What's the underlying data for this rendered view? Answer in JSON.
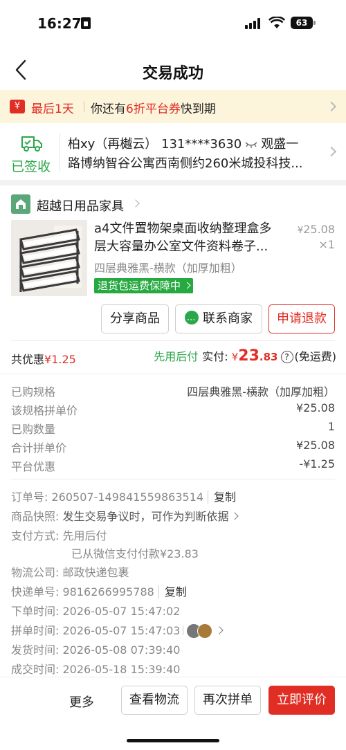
{
  "status_bar": {
    "time": "16:27",
    "battery": "63"
  },
  "nav": {
    "title": "交易成功"
  },
  "coupon_banner": {
    "icon_glyph": "¥",
    "deadline": "最后1天",
    "text_prefix": "你还有",
    "highlight": "6折平台券",
    "text_suffix": "快到期"
  },
  "delivery": {
    "status": "已签收",
    "contact": "柏xy（再樾云） 131****3630",
    "address_part1": "观盛一",
    "address_line2": "路博纳智谷公寓西南侧约260米城投科技..."
  },
  "store": {
    "name": "超越日用品家具"
  },
  "product": {
    "title": "a4文件置物架桌面收纳整理盒多层大容量办公室文件资料卷子...",
    "price_currency": "¥",
    "price": "25.08",
    "quantity": "×1",
    "spec": "四层典雅黑-横款（加厚加粗）",
    "guarantee": "退货包运费保障中"
  },
  "actions": {
    "share": "分享商品",
    "contact": "联系商家",
    "refund": "申请退款"
  },
  "summary": {
    "discount_label": "共优惠",
    "discount_value": "¥1.25",
    "pay_later": "先用后付",
    "paid_label": "实付:",
    "paid_currency": "¥",
    "paid_int": "23",
    "paid_dec": ".83",
    "help": "?",
    "shipping": "(免运费)"
  },
  "details": [
    {
      "label": "已购规格",
      "value": "四层典雅黑-横款（加厚加粗）"
    },
    {
      "label": "该规格拼单价",
      "value": "¥25.08"
    },
    {
      "label": "已购数量",
      "value": "1"
    },
    {
      "label": "合计拼单价",
      "value": "¥25.08"
    },
    {
      "label": "平台优惠",
      "value": "-¥1.25"
    }
  ],
  "order_info": {
    "order_no_label": "订单号:",
    "order_no": "260507-149841559863514",
    "copy": "复制",
    "snapshot_label": "商品快照:",
    "snapshot": "发生交易争议时，可作为判断依据",
    "payment_label": "支付方式:",
    "payment": "先用后付",
    "payment_note": "已从微信支付付款¥23.83",
    "logistics_label": "物流公司:",
    "logistics": "邮政快递包裹",
    "tracking_label": "快递单号:",
    "tracking": "9816266995788",
    "order_time_label": "下单时间:",
    "order_time": "2026-05-07 15:47:02",
    "group_time_label": "拼单时间:",
    "group_time": "2026-05-07 15:47:03",
    "ship_time_label": "发货时间:",
    "ship_time": "2026-05-08 07:39:40",
    "deal_time_label": "成交时间:",
    "deal_time": "2026-05-18 15:39:40"
  },
  "bottom_bar": {
    "more": "更多",
    "logistics": "查看物流",
    "reorder": "再次拼单",
    "review": "立即评价"
  },
  "colors": {
    "accent_red": "#e02e24",
    "green": "#2aa74a",
    "banner_bg": "#fdf4dc"
  }
}
